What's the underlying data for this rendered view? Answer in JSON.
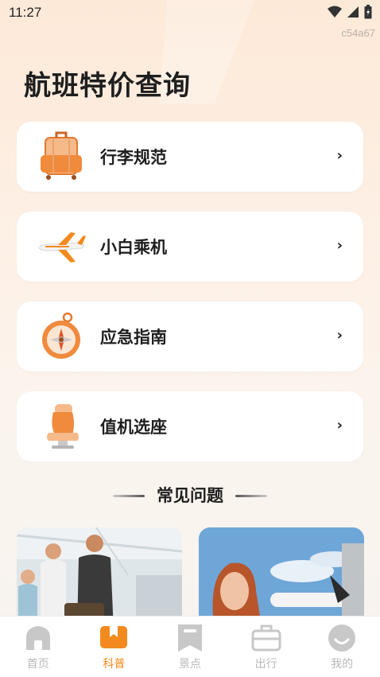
{
  "status": {
    "time": "11:27"
  },
  "build_id": "c54a67",
  "page": {
    "title": "航班特价查询"
  },
  "cards": [
    {
      "label": "行李规范",
      "icon": "luggage-icon"
    },
    {
      "label": "小白乘机",
      "icon": "airplane-icon"
    },
    {
      "label": "应急指南",
      "icon": "compass-icon"
    },
    {
      "label": "值机选座",
      "icon": "seat-icon"
    }
  ],
  "chevron": "›",
  "faq": {
    "title": "常见问题"
  },
  "tabs": [
    {
      "label": "首页",
      "icon": "home-icon",
      "active": false
    },
    {
      "label": "科普",
      "icon": "book-icon",
      "active": true
    },
    {
      "label": "景点",
      "icon": "bookmark-icon",
      "active": false
    },
    {
      "label": "出行",
      "icon": "briefcase-icon",
      "active": false
    },
    {
      "label": "我的",
      "icon": "profile-icon",
      "active": false
    }
  ],
  "colors": {
    "accent": "#f28a1e",
    "inactive": "#c8c8c8"
  }
}
